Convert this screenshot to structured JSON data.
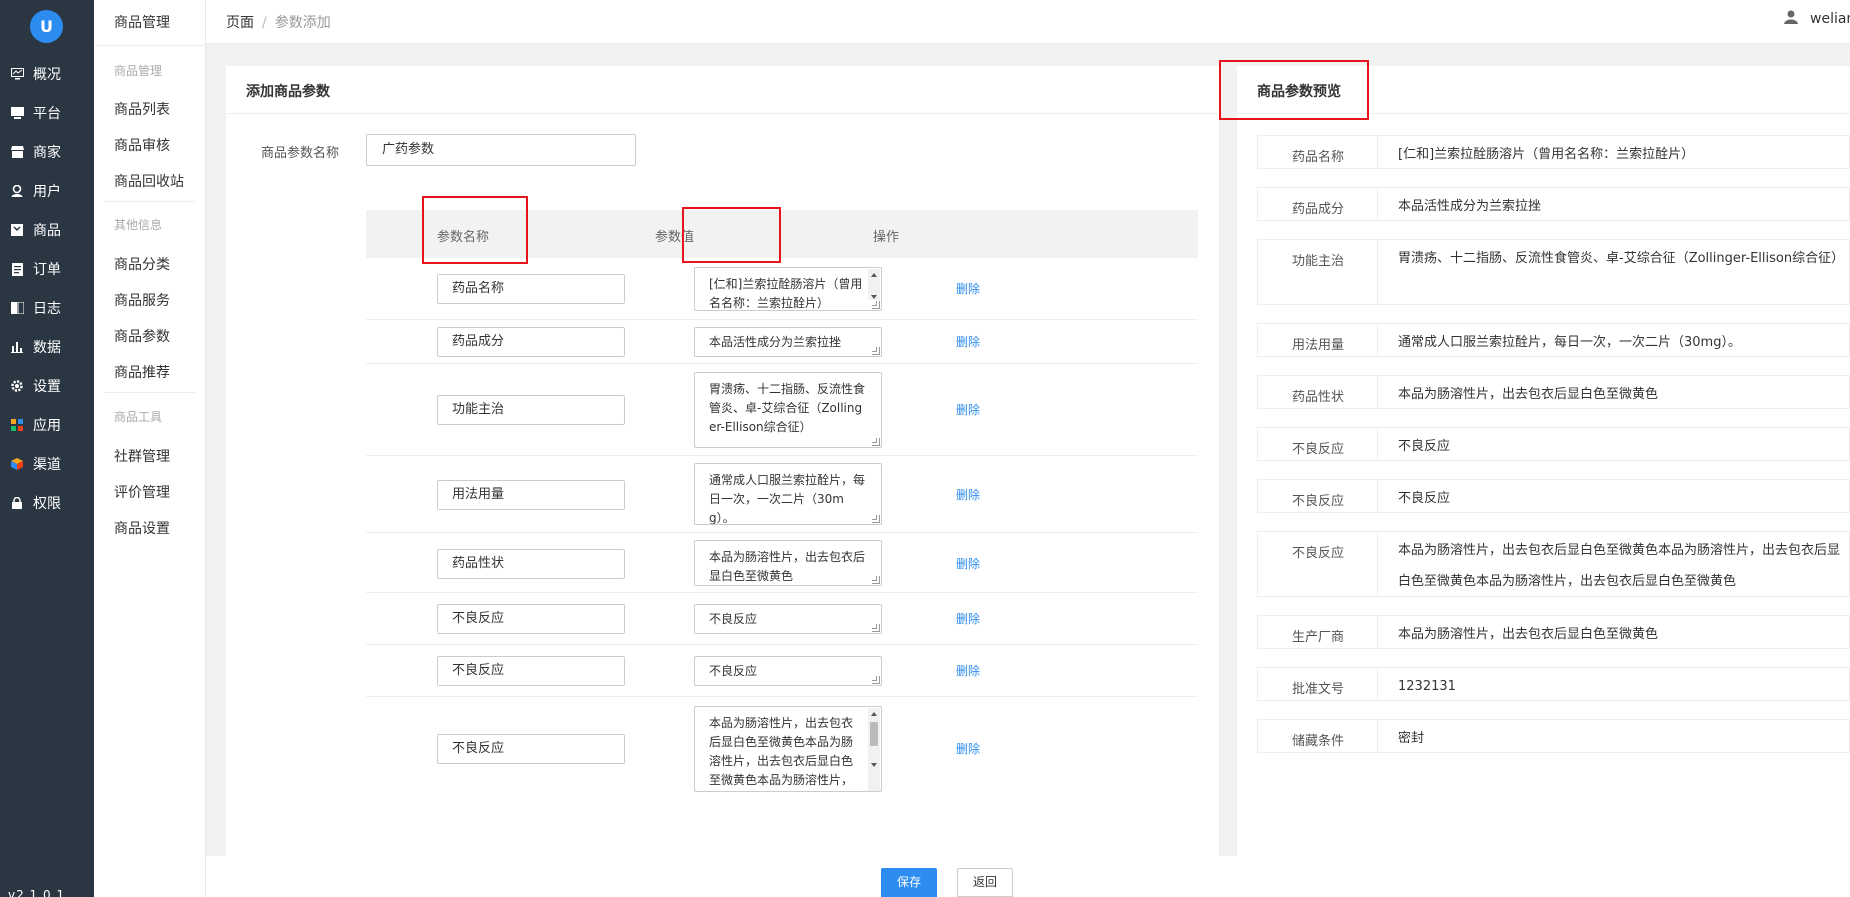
{
  "nav": {
    "logo": "U",
    "items": [
      {
        "label": "概况",
        "icon": "monitor-icon"
      },
      {
        "label": "平台",
        "icon": "desktop-icon"
      },
      {
        "label": "商家",
        "icon": "store-icon"
      },
      {
        "label": "用户",
        "icon": "user-icon"
      },
      {
        "label": "商品",
        "icon": "product-icon"
      },
      {
        "label": "订单",
        "icon": "order-icon"
      },
      {
        "label": "日志",
        "icon": "log-icon"
      },
      {
        "label": "数据",
        "icon": "chart-icon"
      },
      {
        "label": "设置",
        "icon": "gear-icon"
      },
      {
        "label": "应用",
        "icon": "apps-icon"
      },
      {
        "label": "渠道",
        "icon": "channel-icon"
      },
      {
        "label": "权限",
        "icon": "lock-icon"
      }
    ],
    "version": "v2.1.0.1"
  },
  "subnav": {
    "title": "商品管理",
    "groups": [
      {
        "label": "商品管理",
        "items": [
          "商品列表",
          "商品审核",
          "商品回收站"
        ]
      },
      {
        "label": "其他信息",
        "items": [
          "商品分类",
          "商品服务",
          "商品参数",
          "商品推荐"
        ]
      },
      {
        "label": "商品工具",
        "items": [
          "社群管理",
          "评价管理",
          "商品设置"
        ]
      }
    ]
  },
  "breadcrumb": {
    "root": "页面",
    "separator": "/",
    "current": "参数添加"
  },
  "user": {
    "name": "weliam"
  },
  "form": {
    "title": "添加商品参数",
    "name_label": "商品参数名称",
    "name_value": "广药参数",
    "columns": {
      "name": "参数名称",
      "value": "参数值",
      "action": "操作"
    },
    "delete_label": "删除",
    "rows": [
      {
        "name": "药品名称",
        "value": "[仁和]兰索拉酫肠溶片（曾用名名称：兰索拉酫片）"
      },
      {
        "name": "药品成分",
        "value": "本品活性成分为兰索拉挫"
      },
      {
        "name": "功能主治",
        "value": "胃溃疡、十二指肠、反流性食管炎、卓-艾综合征（Zollinger-Ellison综合征）"
      },
      {
        "name": "用法用量",
        "value": "通常成人口服兰索拉酫片，每日一次，一次二片（30mg）。"
      },
      {
        "name": "药品性状",
        "value": "本品为肠溶性片，出去包衣后显白色至微黄色"
      },
      {
        "name": "不良反应",
        "value": "不良反应"
      },
      {
        "name": "不良反应",
        "value": "不良反应"
      },
      {
        "name": "不良反应",
        "value": "本品为肠溶性片，出去包衣后显白色至微黄色本品为肠溶性片，出去包衣后显白色至微黄色本品为肠溶性片，出去包衣后显白色至微黄色"
      }
    ]
  },
  "preview": {
    "title": "商品参数预览",
    "rows": [
      {
        "name": "药品名称",
        "value": "[仁和]兰索拉酫肠溶片（曾用名名称：兰索拉酫片）"
      },
      {
        "name": "药品成分",
        "value": "本品活性成分为兰索拉挫"
      },
      {
        "name": "功能主治",
        "value": "胃溃疡、十二指肠、反流性食管炎、卓-艾综合征（Zollinger-Ellison综合征）"
      },
      {
        "name": "用法用量",
        "value": "通常成人口服兰索拉酫片，每日一次，一次二片（30mg）。"
      },
      {
        "name": "药品性状",
        "value": "本品为肠溶性片，出去包衣后显白色至微黄色"
      },
      {
        "name": "不良反应",
        "value": "不良反应"
      },
      {
        "name": "不良反应",
        "value": "不良反应"
      },
      {
        "name": "不良反应",
        "value": "本品为肠溶性片，出去包衣后显白色至微黄色本品为肠溶性片，出去包衣后显白色至微黄色本品为肠溶性片，出去包衣后显白色至微黄色"
      },
      {
        "name": "生产厂商",
        "value": "本品为肠溶性片，出去包衣后显白色至微黄色"
      },
      {
        "name": "批准文号",
        "value": "1232131"
      },
      {
        "name": "储藏条件",
        "value": "密封"
      }
    ]
  },
  "actions": {
    "save": "保存",
    "back": "返回"
  },
  "colors": {
    "primary": "#2d8cf0",
    "nav_bg": "#2b3643",
    "highlight": "#e8141b"
  }
}
